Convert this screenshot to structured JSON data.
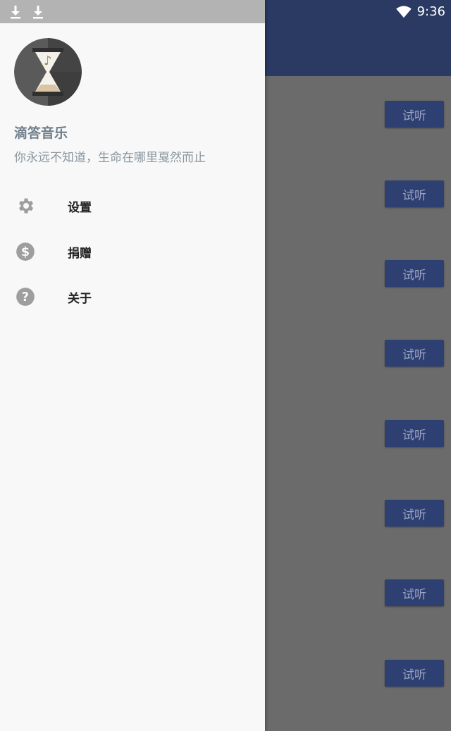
{
  "status_bar": {
    "time": "9:36"
  },
  "drawer": {
    "app_name": "滴答音乐",
    "slogan": "你永远不知道，生命在哪里戛然而止",
    "menu": [
      {
        "label": "设置",
        "icon": "gear-icon"
      },
      {
        "label": "捐赠",
        "icon": "dollar-icon"
      },
      {
        "label": "关于",
        "icon": "help-icon"
      }
    ]
  },
  "list": {
    "button_label": "试听",
    "buttons": [
      "试听",
      "试听",
      "试听",
      "试听",
      "试听",
      "试听",
      "试听",
      "试听"
    ]
  },
  "colors": {
    "toolbar": "#2b3a63",
    "button": "#2e3f72",
    "scrim": "#6b6b6b",
    "drawer_bg": "#f8f8f8"
  }
}
